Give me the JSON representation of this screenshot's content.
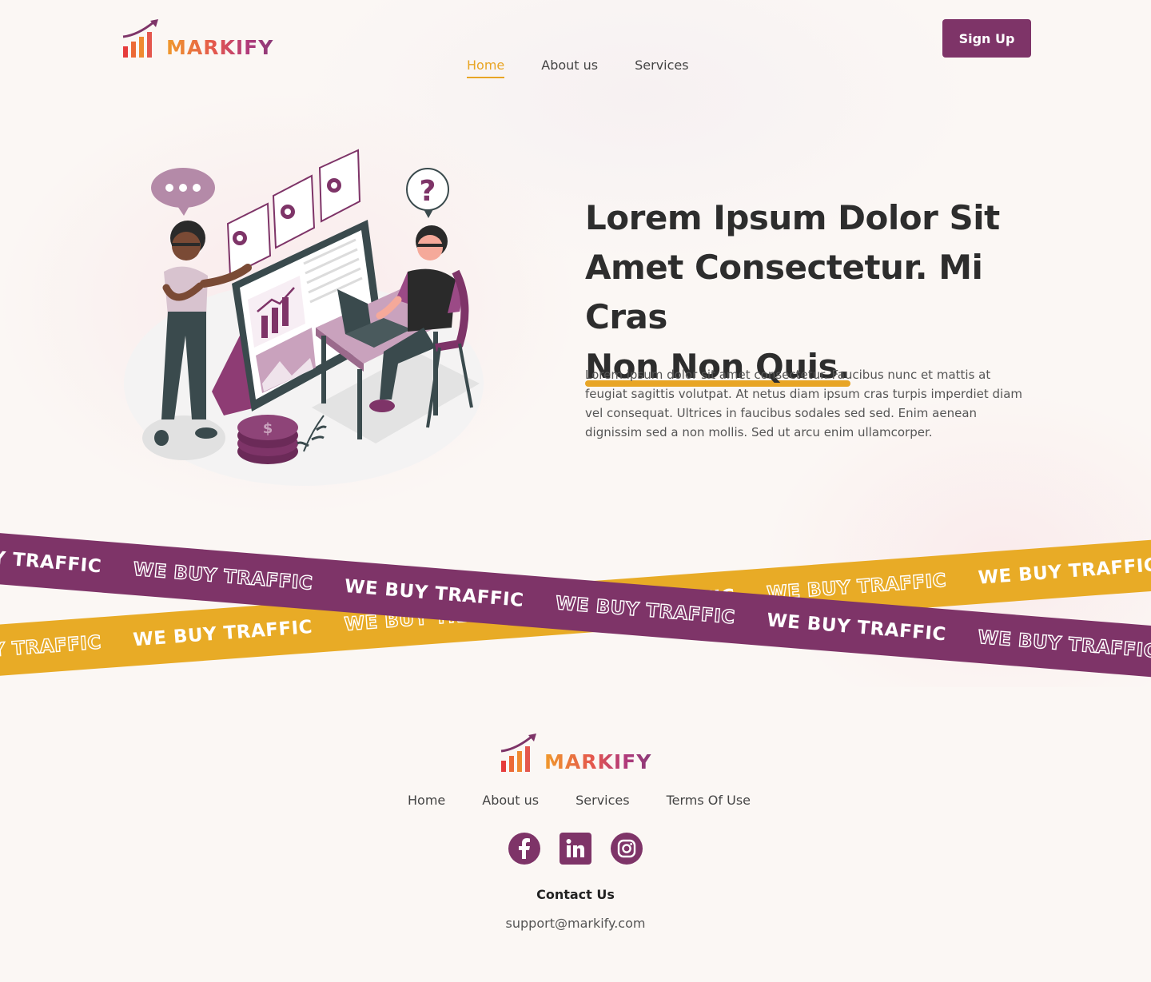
{
  "brand": {
    "name": "MARKIFY"
  },
  "header": {
    "signup_label": "Sign Up",
    "nav": [
      {
        "label": "Home",
        "active": true
      },
      {
        "label": "About us",
        "active": false
      },
      {
        "label": "Services",
        "active": false
      }
    ]
  },
  "hero": {
    "title_line1": "Lorem Ipsum Dolor Sit",
    "title_line2": "Amet Consectetur. Mi Cras",
    "title_highlight": "Non Non Quis.",
    "description": "Lorem ipsum dolor sit amet consectetur. Faucibus nunc et mattis at feugiat sagittis volutpat. At netus diam ipsum cras turpis imperdiet diam vel consequat. Ultrices in faucibus sodales sed sed. Enim aenean dignissim sed a non mollis. Sed ut arcu enim ullamcorper."
  },
  "banner": {
    "text": "WE BUY TRAFFIC"
  },
  "footer": {
    "nav": [
      {
        "label": "Home"
      },
      {
        "label": "About us"
      },
      {
        "label": "Services"
      },
      {
        "label": "Terms Of Use"
      }
    ],
    "socials": [
      "facebook-icon",
      "linkedin-icon",
      "instagram-icon"
    ],
    "contact_title": "Contact Us",
    "contact_email": "support@markify.com"
  },
  "colors": {
    "primary": "#7e3468",
    "accent": "#e8a525",
    "background": "#fbf7f4",
    "text": "#2d2d2d"
  }
}
